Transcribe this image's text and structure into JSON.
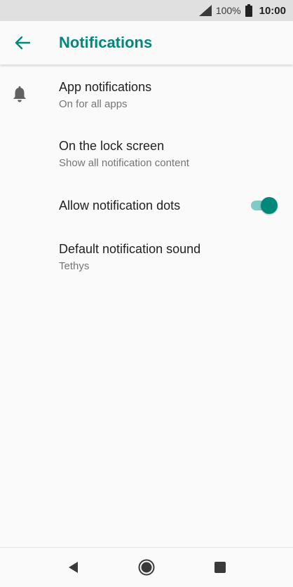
{
  "status_bar": {
    "battery_percent": "100%",
    "time": "10:00",
    "icons": [
      "signal-icon",
      "battery-icon"
    ]
  },
  "app_bar": {
    "title": "Notifications",
    "back_icon": "arrow-left-icon"
  },
  "settings": [
    {
      "title": "App notifications",
      "summary": "On for all apps",
      "icon": "bell-icon"
    },
    {
      "title": "On the lock screen",
      "summary": "Show all notification content"
    },
    {
      "title": "Allow notification dots",
      "toggle": true
    },
    {
      "title": "Default notification sound",
      "summary": "Tethys"
    }
  ],
  "nav_bar": {
    "icons": [
      "back-triangle-icon",
      "home-circle-icon",
      "recents-square-icon"
    ]
  },
  "colors": {
    "accent": "#00897b",
    "switch_track": "#80cbc4",
    "status_bar_bg": "#e0e0e0"
  }
}
